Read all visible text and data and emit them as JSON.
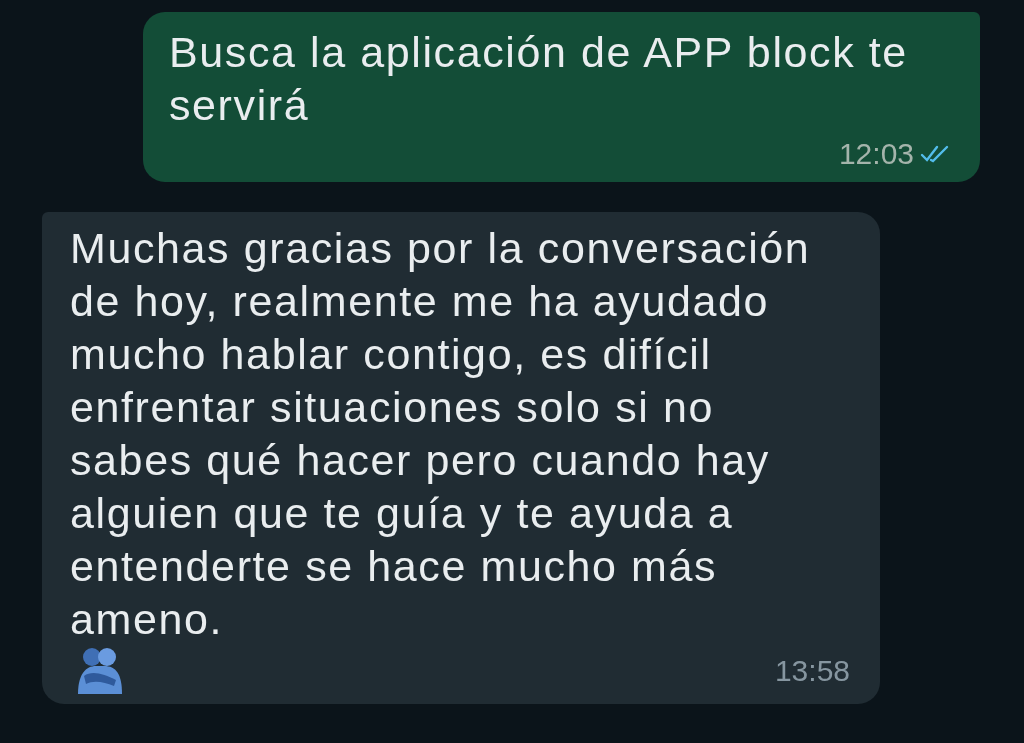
{
  "messages": [
    {
      "kind": "outgoing",
      "text": "Busca la aplicación de APP block te servirá",
      "time": "12:03",
      "read": true
    },
    {
      "kind": "incoming",
      "text": "Muchas gracias por la conversación de hoy, realmente me ha ayudado mucho hablar contigo, es difícil enfrentar situaciones solo si no sabes qué hacer pero cuando hay alguien que te guía y te ayuda a entenderte se hace mucho más ameno.",
      "time": "13:58",
      "emoji": true
    }
  ]
}
